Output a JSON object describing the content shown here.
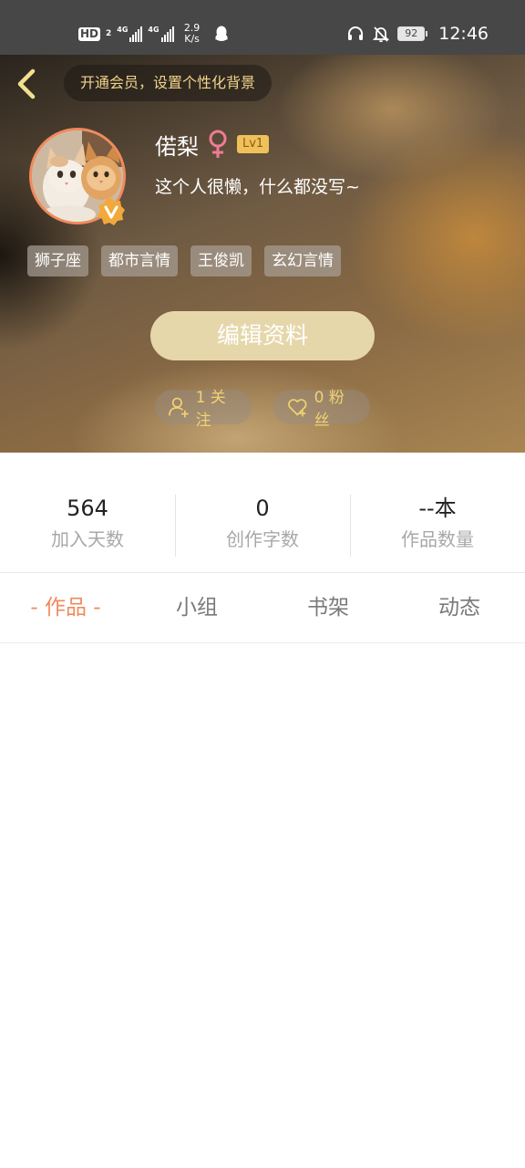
{
  "status_bar": {
    "hd_label": "HD",
    "hd_sub": "2",
    "net1_label": "4G",
    "net2_label": "4G",
    "speed_value": "2.9",
    "speed_unit": "K/s",
    "battery": "92",
    "time": "12:46"
  },
  "header": {
    "vip_prompt": "开通会员，设置个性化背景"
  },
  "profile": {
    "name": "偌梨",
    "gender_symbol": "♀",
    "level": "Lv1",
    "bio": "这个人很懒，什么都没写~",
    "tags": [
      "狮子座",
      "都市言情",
      "王俊凯",
      "玄幻言情"
    ],
    "edit_label": "编辑资料",
    "following": "1 关注",
    "fans": "0 粉丝"
  },
  "stats": [
    {
      "value": "564",
      "label": "加入天数"
    },
    {
      "value": "0",
      "label": "创作字数"
    },
    {
      "value": "--本",
      "label": "作品数量"
    }
  ],
  "tabs": [
    "- 作品 -",
    "小组",
    "书架",
    "动态"
  ],
  "colors": {
    "accent": "#f08a5d",
    "gold_text": "#f0d271",
    "edit_button": "#e6d7ab",
    "level_badge": "#efc15a"
  }
}
